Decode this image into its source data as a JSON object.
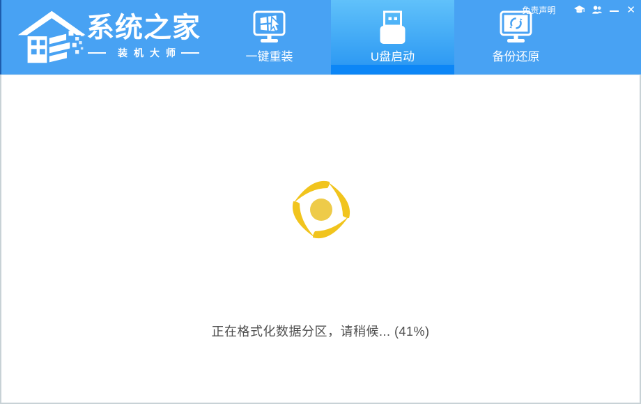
{
  "logo": {
    "title": "系统之家",
    "subtitle": "装机大师"
  },
  "tabs": [
    {
      "label": "一键重装",
      "icon": "monitor-windows-icon",
      "active": false
    },
    {
      "label": "U盘启动",
      "icon": "usb-drive-icon",
      "active": true
    },
    {
      "label": "备份还原",
      "icon": "monitor-restore-icon",
      "active": false
    }
  ],
  "window_controls": {
    "disclaimer_label": "免责声明",
    "icons": [
      {
        "name": "graduation-cap-icon"
      },
      {
        "name": "users-icon"
      },
      {
        "name": "minimize-icon",
        "glyph": "─"
      },
      {
        "name": "close-icon",
        "glyph": "✕"
      }
    ],
    "close_glyph": "✕"
  },
  "status": {
    "text": "正在格式化数据分区，请稍候... (41%)",
    "progress_percent": 41
  },
  "colors": {
    "header_blue": "#48a2f3",
    "active_tab_gradient_top": "#60c1fa",
    "active_tab_gradient_bottom": "#2e9af3",
    "active_tab_strip": "#0c86f6",
    "spinner_arc": "#f1c41d",
    "spinner_center": "#eecb49",
    "status_text": "#4e4e4e",
    "content_background": "#ffffff",
    "content_border": "#c8d2d6",
    "header_left_edge": "#1d5cad"
  }
}
